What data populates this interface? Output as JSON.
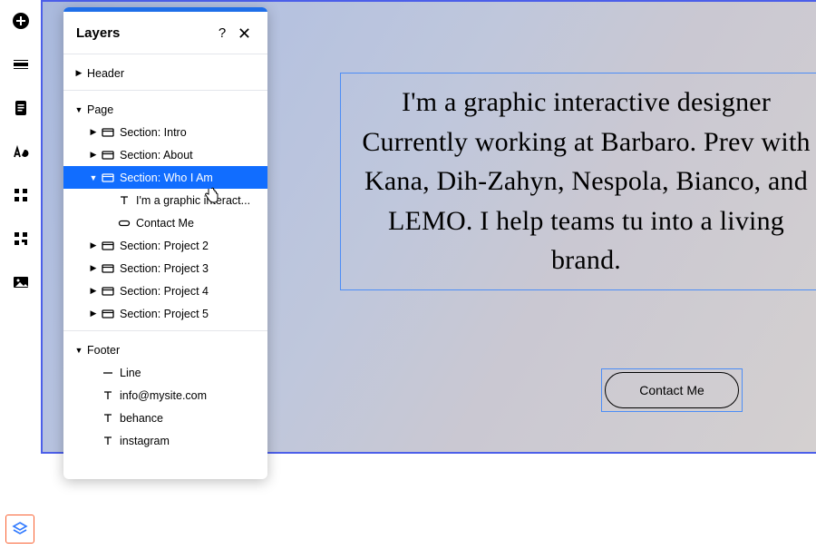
{
  "panel": {
    "title": "Layers",
    "help": "?",
    "tree": {
      "header": {
        "label": "Header"
      },
      "page": {
        "label": "Page",
        "sections": {
          "intro": {
            "label": "Section: Intro"
          },
          "about": {
            "label": "Section: About"
          },
          "whoiam": {
            "label": "Section: Who I Am",
            "children": {
              "text": {
                "label": "I'm a graphic interact..."
              },
              "contact": {
                "label": "Contact Me"
              }
            }
          },
          "project2": {
            "label": "Section: Project 2"
          },
          "project3": {
            "label": "Section: Project 3"
          },
          "project4": {
            "label": "Section: Project 4"
          },
          "project5": {
            "label": "Section: Project 5"
          }
        }
      },
      "footer": {
        "label": "Footer",
        "children": {
          "line": {
            "label": "Line"
          },
          "email": {
            "label": "info@mysite.com"
          },
          "behance": {
            "label": "behance"
          },
          "instagram": {
            "label": "instagram"
          }
        }
      }
    }
  },
  "canvas": {
    "hero_text": "I'm a graphic interactive designer Currently working at Barbaro. Prev with Kana, Dih-Zahyn, Nespola, Bianco, and LEMO. I help teams tu into a living brand.",
    "contact_label": "Contact Me"
  }
}
